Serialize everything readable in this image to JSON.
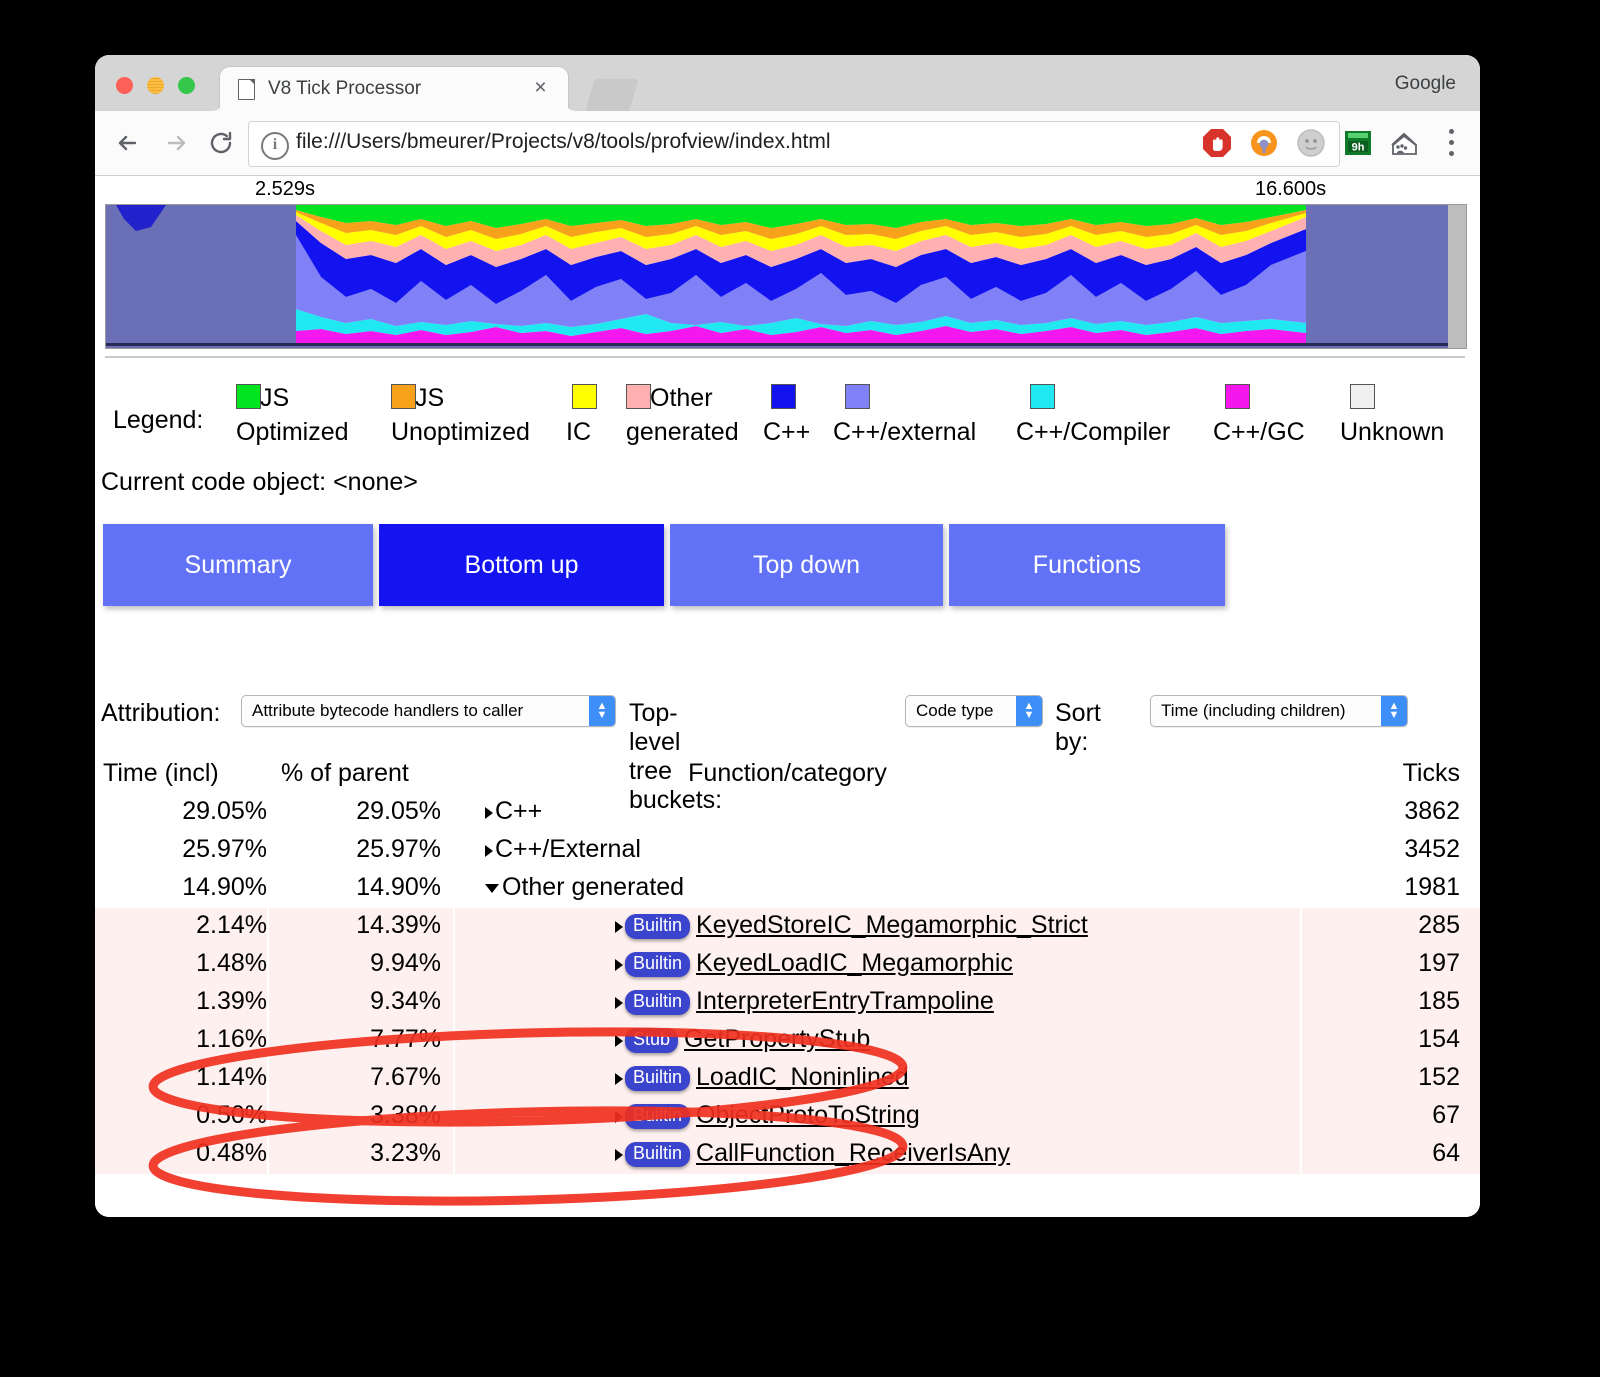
{
  "browser": {
    "tab": {
      "title": "V8 Tick Processor",
      "close_label": "×"
    },
    "omnibox": {
      "url": "file:///Users/bmeurer/Projects/v8/tools/profview/index.html",
      "info_icon": "i",
      "star_icon": "☆"
    },
    "profile_label": "Google",
    "extensions": [
      {
        "name": "adblock-icon"
      },
      {
        "name": "lastpass-icon"
      },
      {
        "name": "gray-extension-icon"
      },
      {
        "name": "9h-badge-icon",
        "text": "9h"
      },
      {
        "name": "paw-house-icon"
      }
    ]
  },
  "timeline": {
    "start_label": "2.529s",
    "end_label": "16.600s"
  },
  "legend": {
    "label": "Legend:",
    "items": [
      {
        "color": "#00e520",
        "line1": "JS",
        "line2": "Optimized"
      },
      {
        "color": "#f8a21c",
        "line1": "JS",
        "line2": "Unoptimized"
      },
      {
        "color": "#ffff00",
        "line1": "",
        "line2": "IC"
      },
      {
        "color": "#ffb0b0",
        "line1": "Other",
        "line2": "generated"
      },
      {
        "color": "#1313f0",
        "line1": "",
        "line2": "C++"
      },
      {
        "color": "#8080f7",
        "line1": "",
        "line2": "C++/external"
      },
      {
        "color": "#20e8f0",
        "line1": "",
        "line2": "C++/Compiler"
      },
      {
        "color": "#f418ee",
        "line1": "",
        "line2": "C++/GC"
      },
      {
        "color": "#f0f0f0",
        "line1": "",
        "line2": "Unknown"
      }
    ]
  },
  "current_code_object": "Current code object: <none>",
  "view_buttons": [
    {
      "label": "Summary",
      "active": false
    },
    {
      "label": "Bottom up",
      "active": true
    },
    {
      "label": "Top down",
      "active": false
    },
    {
      "label": "Functions",
      "active": false
    }
  ],
  "controls": {
    "attribution_label": "Attribution:",
    "attribution_value": "Attribute bytecode handlers to caller",
    "buckets_label": "Top-level tree buckets:",
    "buckets_value": "Code type",
    "sort_label": "Sort by:",
    "sort_value": "Time (including children)"
  },
  "table": {
    "headers": {
      "time": "Time (incl)",
      "percent": "% of parent",
      "function": "Function/category",
      "ticks": "Ticks"
    },
    "rows": [
      {
        "time": "29.05%",
        "percent": "29.05%",
        "tri": "closed",
        "tag": "",
        "fn": "C++",
        "link": false,
        "ticks": "3862",
        "shaded": false
      },
      {
        "time": "25.97%",
        "percent": "25.97%",
        "tri": "closed",
        "tag": "",
        "fn": "C++/External",
        "link": false,
        "ticks": "3452",
        "shaded": false
      },
      {
        "time": "14.90%",
        "percent": "14.90%",
        "tri": "open",
        "tag": "",
        "fn": "Other generated",
        "link": false,
        "ticks": "1981",
        "shaded": false
      },
      {
        "time": "2.14%",
        "percent": "14.39%",
        "tri": "closed",
        "tag": "Builtin",
        "fn": "KeyedStoreIC_Megamorphic_Strict",
        "link": true,
        "ticks": "285",
        "shaded": true
      },
      {
        "time": "1.48%",
        "percent": "9.94%",
        "tri": "closed",
        "tag": "Builtin",
        "fn": "KeyedLoadIC_Megamorphic",
        "link": true,
        "ticks": "197",
        "shaded": true
      },
      {
        "time": "1.39%",
        "percent": "9.34%",
        "tri": "closed",
        "tag": "Builtin",
        "fn": "InterpreterEntryTrampoline",
        "link": true,
        "ticks": "185",
        "shaded": true
      },
      {
        "time": "1.16%",
        "percent": "7.77%",
        "tri": "closed",
        "tag": "Stub",
        "fn": "GetPropertyStub",
        "link": true,
        "ticks": "154",
        "shaded": true
      },
      {
        "time": "1.14%",
        "percent": "7.67%",
        "tri": "closed",
        "tag": "Builtin",
        "fn": "LoadIC_Noninlined",
        "link": true,
        "ticks": "152",
        "shaded": true
      },
      {
        "time": "0.50%",
        "percent": "3.38%",
        "tri": "closed",
        "tag": "Builtin",
        "fn": "ObjectProtoToString",
        "link": true,
        "ticks": "67",
        "shaded": true
      },
      {
        "time": "0.48%",
        "percent": "3.23%",
        "tri": "closed",
        "tag": "Builtin",
        "fn": "CallFunction_ReceiverIsAny",
        "link": true,
        "ticks": "64",
        "shaded": true
      }
    ]
  },
  "annotations": {
    "color": "#f03020",
    "circled_rows": [
      "GetPropertyStub",
      "ObjectProtoToString"
    ]
  },
  "chart_data": {
    "type": "area",
    "title": "",
    "xlabel": "",
    "ylabel": "",
    "x_range_labels": [
      "2.529s",
      "16.600s"
    ],
    "stacked": true,
    "legend_position": "below",
    "series": [
      {
        "name": "C++/GC",
        "color": "#f418ee"
      },
      {
        "name": "C++/Compiler",
        "color": "#20e8f0"
      },
      {
        "name": "C++/external",
        "color": "#8080f7"
      },
      {
        "name": "C++",
        "color": "#1313f0"
      },
      {
        "name": "Other generated",
        "color": "#ffb0b0"
      },
      {
        "name": "IC",
        "color": "#ffff00"
      },
      {
        "name": "JS Unoptimized",
        "color": "#f8a21c"
      },
      {
        "name": "JS Optimized",
        "color": "#00e520"
      },
      {
        "name": "Unknown",
        "color": "#f0f0f0"
      }
    ]
  }
}
